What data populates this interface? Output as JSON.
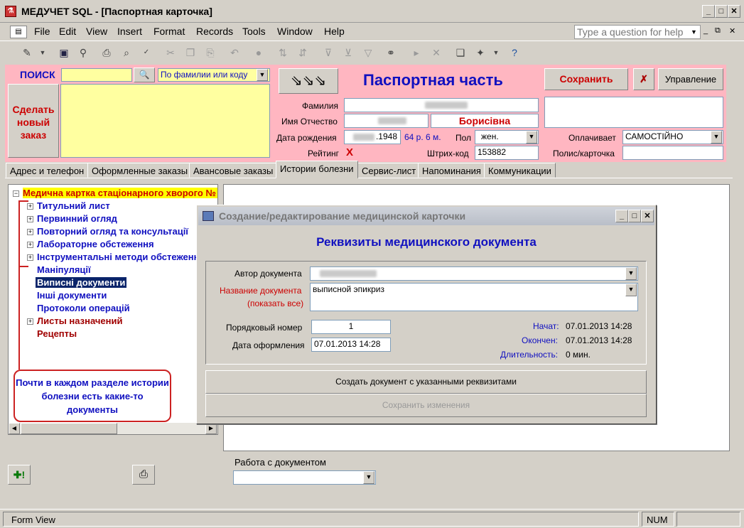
{
  "window": {
    "title": "МЕДУЧЕТ SQL - [Паспортная карточка]",
    "app_icon": "access-icon"
  },
  "menu": [
    "File",
    "Edit",
    "View",
    "Insert",
    "Format",
    "Records",
    "Tools",
    "Window",
    "Help"
  ],
  "help_placeholder": "Type a question for help",
  "search": {
    "label": "ПОИСК",
    "value": "",
    "mode": "По фамилии или коду"
  },
  "new_order_button": "Сделать новый заказ",
  "header_title": "Паспортная часть",
  "save_button": "Сохранить",
  "manage_button": "Управление",
  "patient": {
    "surname_label": "Фамилия",
    "name_label": "Имя Отчество",
    "patronymic": "Борисівна",
    "dob_label": "Дата рождения",
    "dob_year": ".1948",
    "age": "64 р. 6 м.",
    "sex_label": "Пол",
    "sex": "жен.",
    "rating_label": "Рейтинг",
    "rating_mark": "X",
    "barcode_label": "Штрих-код",
    "barcode": "153882",
    "payer_label": "Оплачивает",
    "payer": "САМОСТІЙНО",
    "policy_label": "Полис/карточка",
    "policy": ""
  },
  "tabs": [
    "Адрес и телефон",
    "Оформленные заказы",
    "Авансовые заказы",
    "Истории болезни",
    "Сервис-лист",
    "Напоминания",
    "Коммуникации"
  ],
  "active_tab": "Истории болезни",
  "tree": {
    "root": "Медична картка стаціонарного хворого №",
    "items": [
      {
        "label": "Титульний лист",
        "expandable": true
      },
      {
        "label": "Первинний огляд",
        "expandable": true
      },
      {
        "label": "Повторний огляд та консультації",
        "expandable": true
      },
      {
        "label": "Лабораторне обстеження",
        "expandable": true
      },
      {
        "label": "Інструментальні методи обстеження",
        "expandable": true
      },
      {
        "label": "Маніпуляції",
        "expandable": false
      },
      {
        "label": "Виписні документи",
        "expandable": false
      },
      {
        "label": "Інші документи",
        "expandable": false
      },
      {
        "label": "Протоколи операцій",
        "expandable": false
      },
      {
        "label": "Листы назначений",
        "expandable": true
      },
      {
        "label": "Рецепты",
        "expandable": false
      }
    ]
  },
  "callout": "Почти в каждом разделе истории болезни есть какие-то документы",
  "doc_work_label": "Работа с документом",
  "dialog": {
    "title": "Создание/редактирование медицинской карточки",
    "heading": "Реквизиты медицинского документа",
    "author_label": "Автор документа",
    "docname_label": "Название документа",
    "show_all_label": "(показать все)",
    "docname_value": "выписной эпикриз",
    "order_label": "Порядковый номер",
    "order_value": "1",
    "date_label": "Дата оформления",
    "date_value": "07.01.2013 14:28",
    "start_label": "Начат:",
    "start_value": "07.01.2013 14:28",
    "end_label": "Окончен:",
    "end_value": "07.01.2013 14:28",
    "duration_label": "Длительность:",
    "duration_value": "0 мин.",
    "create_button": "Создать документ с указанными реквизитами",
    "save_button": "Сохранить изменения"
  },
  "status": {
    "left": "Form View",
    "num": "NUM"
  },
  "colors": {
    "header_bg": "#ffb6c1",
    "search_bg": "#ffffa0",
    "accent_red": "#cc0000",
    "accent_blue": "#1010c0"
  }
}
